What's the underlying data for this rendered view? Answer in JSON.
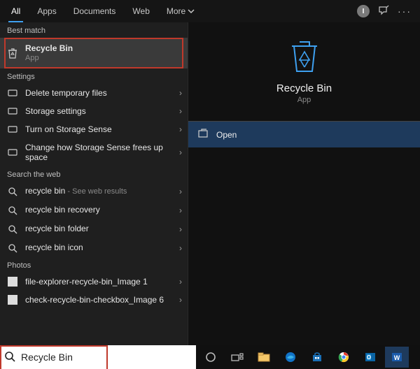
{
  "tabs": {
    "all": "All",
    "apps": "Apps",
    "documents": "Documents",
    "web": "Web",
    "more": "More"
  },
  "header": {
    "avatar_initial": "I"
  },
  "left": {
    "best_match_label": "Best match",
    "best_match": {
      "title": "Recycle Bin",
      "sub": "App"
    },
    "settings_label": "Settings",
    "settings": [
      "Delete temporary files",
      "Storage settings",
      "Turn on Storage Sense",
      "Change how Storage Sense frees up space"
    ],
    "web_label": "Search the web",
    "web": [
      {
        "q": "recycle bin",
        "hint": " - See web results"
      },
      {
        "q": "recycle bin recovery",
        "hint": ""
      },
      {
        "q": "recycle bin folder",
        "hint": ""
      },
      {
        "q": "recycle bin icon",
        "hint": ""
      }
    ],
    "photos_label": "Photos",
    "photos": [
      "file-explorer-recycle-bin_Image 1",
      "check-recycle-bin-checkbox_Image 6"
    ]
  },
  "preview": {
    "title": "Recycle Bin",
    "sub": "App",
    "open": "Open"
  },
  "search": {
    "value": "Recycle Bin",
    "placeholder": "Type here to search"
  },
  "colors": {
    "accent": "#3ea0f0",
    "action_bg": "#1e3a5c",
    "highlight": "#c0392b"
  }
}
